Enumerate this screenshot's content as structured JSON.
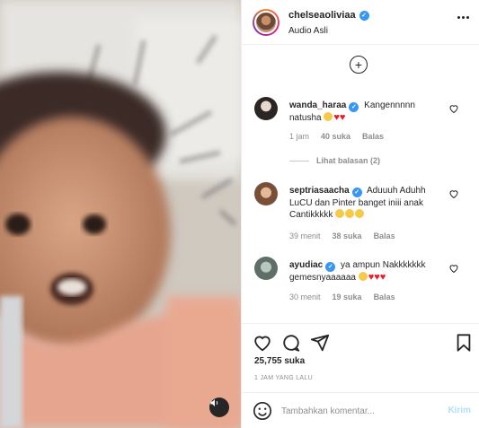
{
  "post": {
    "username": "chelseaoliviaa",
    "audio": "Audio Asli",
    "verified": true
  },
  "comments": [
    {
      "username": "wanda_haraa",
      "text": "Kangennnnn natusha",
      "emojis": [
        "sad-face-icon",
        "heart-icon",
        "heart-icon"
      ],
      "time": "1 jam",
      "likes": "40 suka",
      "reply": "Balas",
      "view_replies": "Lihat balasan (2)"
    },
    {
      "username": "septriasaacha",
      "text": "Aduuuh Aduhh LuCU dan Pinter banget iniii anak Cantikkkkk",
      "emojis": [
        "heart-eyes-icon",
        "heart-eyes-icon",
        "heart-eyes-icon"
      ],
      "time": "39 menit",
      "likes": "38 suka",
      "reply": "Balas"
    },
    {
      "username": "ayudiac",
      "text": "ya ampun Nakkkkkkk gemesnyaaaaaa",
      "emojis": [
        "laughing-face-icon",
        "heart-icon",
        "heart-icon",
        "heart-icon"
      ],
      "time": "30 menit",
      "likes": "19 suka",
      "reply": "Balas"
    }
  ],
  "stats": {
    "likes": "25,755 suka",
    "time_ago": "1 JAM YANG LALU"
  },
  "add_comment": {
    "placeholder": "Tambahkan komentar...",
    "post_label": "Kirim"
  },
  "colors": {
    "verified": "#3897f0",
    "heart": "#ed1c24",
    "post_disabled": "#b2dffc",
    "muted": "#8e8e8e"
  }
}
